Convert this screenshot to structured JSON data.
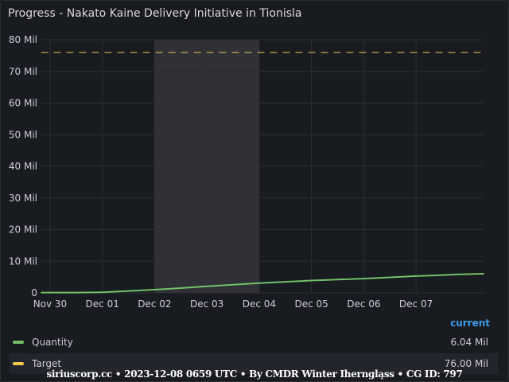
{
  "panel": {
    "title": "Progress - Nakato Kaine Delivery Initiative in Tionisla"
  },
  "colors": {
    "quantity": "#73bf69",
    "target": "#f2c94c",
    "accent": "#3d9be9",
    "grid": "#2c2f35",
    "highlight": "#2f3136"
  },
  "chart_data": {
    "type": "line",
    "ylim": [
      0,
      80
    ],
    "y_unit": "Mil",
    "y_ticks": [
      0,
      10,
      20,
      30,
      40,
      50,
      60,
      70,
      80
    ],
    "y_tick_labels": [
      "0",
      "10 Mil",
      "20 Mil",
      "30 Mil",
      "40 Mil",
      "50 Mil",
      "60 Mil",
      "70 Mil",
      "80 Mil"
    ],
    "x_range": [
      "2023-11-29T20:00",
      "2023-12-08T07:00"
    ],
    "x_ticks": [
      "2023-11-30",
      "2023-12-01",
      "2023-12-02",
      "2023-12-03",
      "2023-12-04",
      "2023-12-05",
      "2023-12-06",
      "2023-12-07"
    ],
    "x_tick_labels": [
      "Nov 30",
      "Dec 01",
      "Dec 02",
      "Dec 03",
      "Dec 04",
      "Dec 05",
      "Dec 06",
      "Dec 07"
    ],
    "highlight_range": [
      "2023-12-02",
      "2023-12-04"
    ],
    "grid": true,
    "series": [
      {
        "name": "Quantity",
        "color": "#73bf69",
        "style": "solid",
        "x": [
          "2023-11-29T20:00",
          "2023-11-30T12:00",
          "2023-12-01T00:00",
          "2023-12-01T12:00",
          "2023-12-02T00:00",
          "2023-12-02T12:00",
          "2023-12-03T00:00",
          "2023-12-03T12:00",
          "2023-12-04T00:00",
          "2023-12-04T12:00",
          "2023-12-05T00:00",
          "2023-12-05T12:00",
          "2023-12-06T00:00",
          "2023-12-06T12:00",
          "2023-12-07T00:00",
          "2023-12-07T12:00",
          "2023-12-07T18:00",
          "2023-12-08T07:00"
        ],
        "y": [
          0.1,
          0.1,
          0.2,
          0.6,
          1.0,
          1.5,
          2.1,
          2.6,
          3.1,
          3.5,
          3.9,
          4.2,
          4.5,
          4.9,
          5.3,
          5.6,
          5.8,
          6.04
        ]
      },
      {
        "name": "Target",
        "color": "#f2c94c",
        "style": "dashed",
        "x": [
          "2023-11-29T20:00",
          "2023-12-08T07:00"
        ],
        "y": [
          76.0,
          76.0
        ]
      }
    ]
  },
  "legend": {
    "header": "current",
    "items": [
      {
        "name": "Quantity",
        "value": "6.04 Mil",
        "color": "#73bf69"
      },
      {
        "name": "Target",
        "value": "76.00 Mil",
        "color": "#f2c94c"
      }
    ]
  },
  "footer": {
    "text": "siriuscorp.cc • 2023-12-08 0659 UTC • By CMDR Winter Iherngląss • CG ID: 797"
  }
}
